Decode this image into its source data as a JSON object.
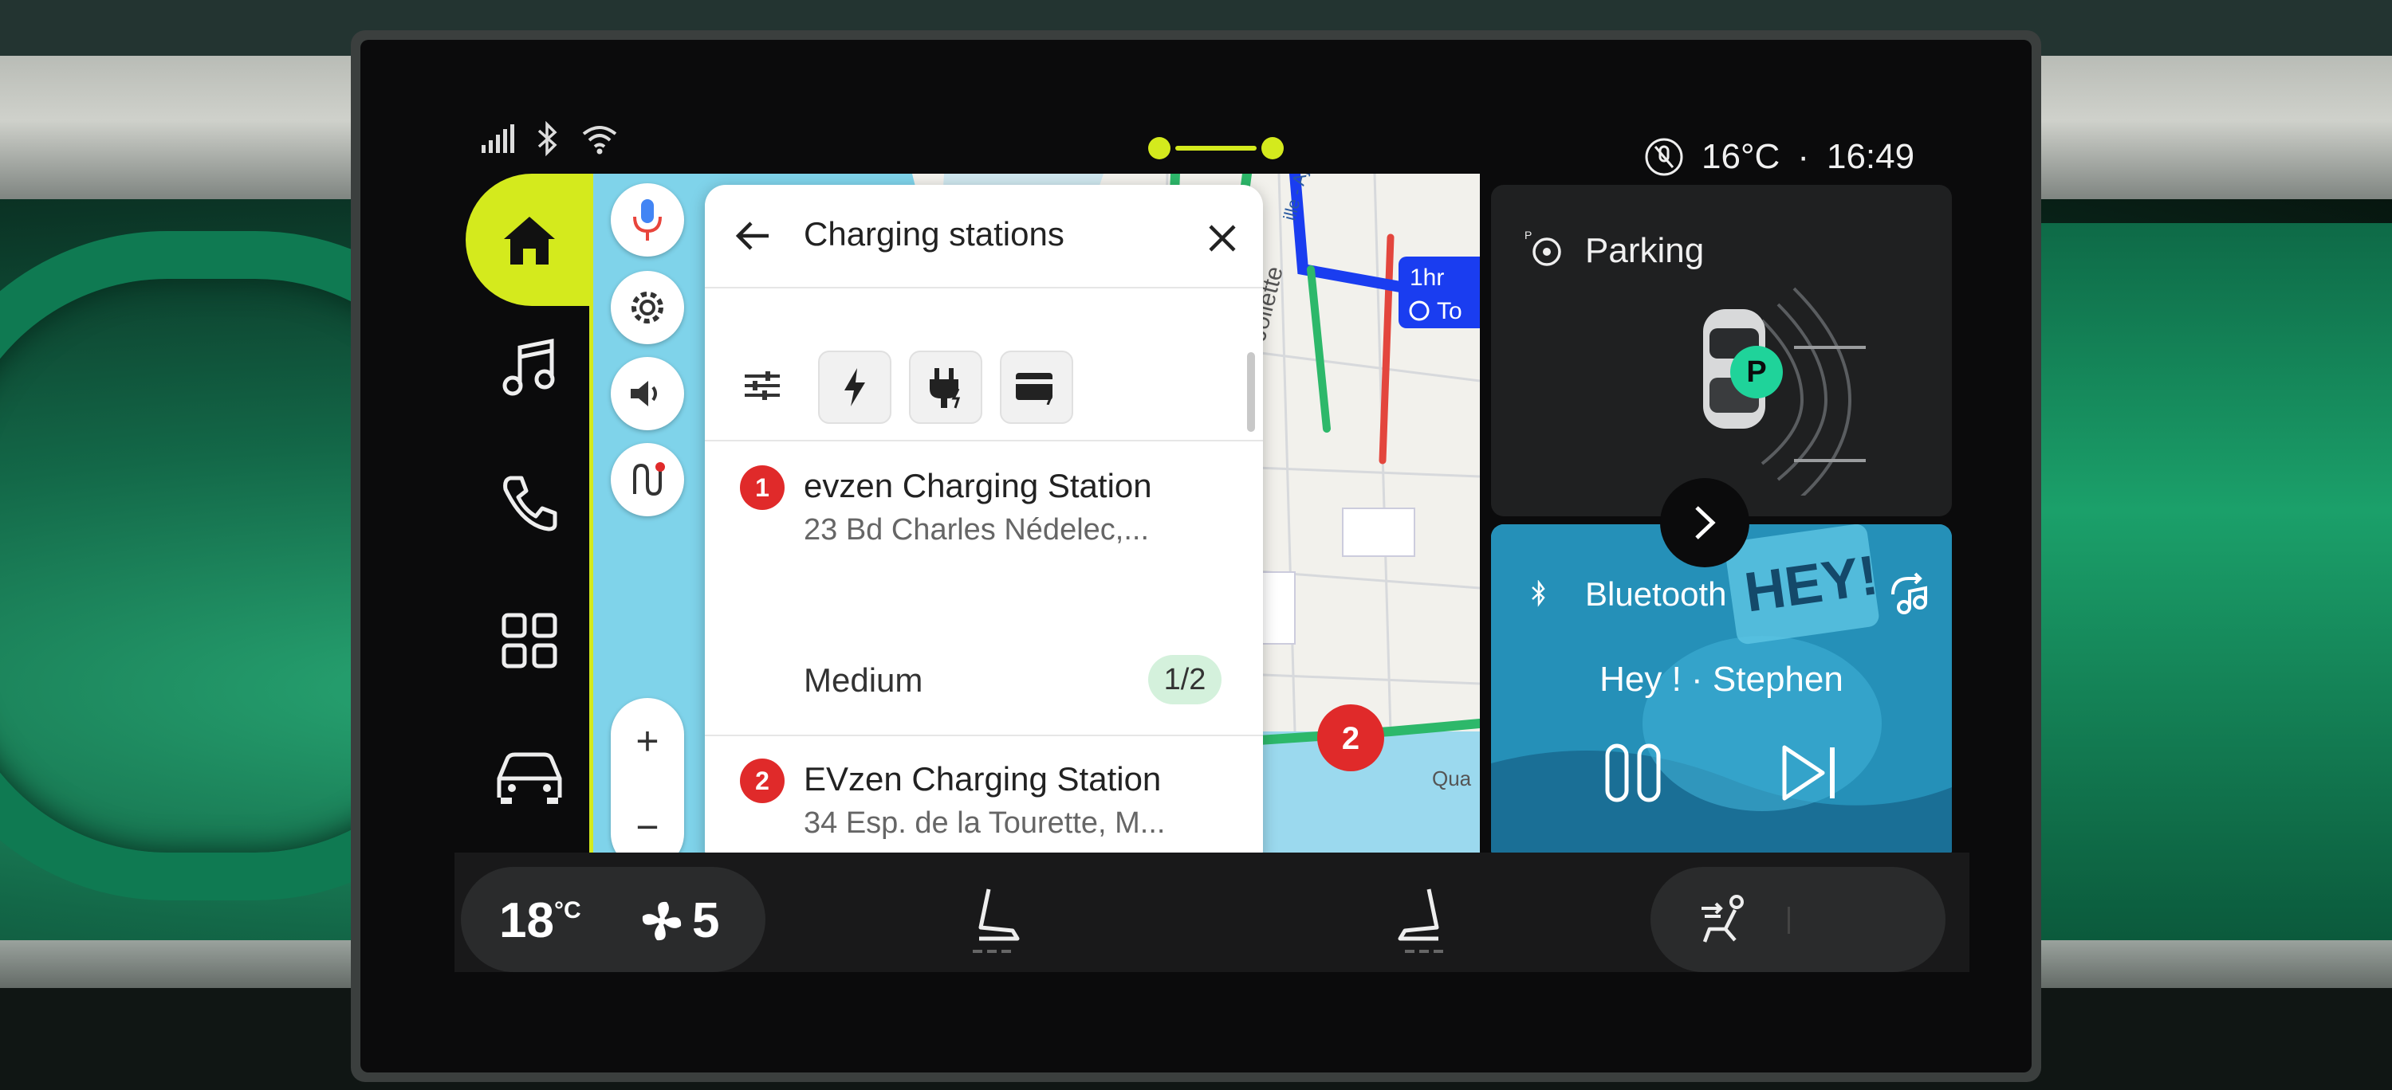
{
  "status_bar": {
    "icons": [
      "signal-icon",
      "bluetooth-icon",
      "wifi-icon"
    ],
    "temperature": "16°C",
    "separator": "·",
    "time": "16:49"
  },
  "rail": {
    "items": [
      {
        "name": "home",
        "icon": "home-icon",
        "active": true
      },
      {
        "name": "music",
        "icon": "music-icon"
      },
      {
        "name": "phone",
        "icon": "phone-icon"
      },
      {
        "name": "apps",
        "icon": "apps-grid-icon"
      },
      {
        "name": "vehicle",
        "icon": "car-icon"
      }
    ]
  },
  "map": {
    "controls": [
      "microphone-icon",
      "settings-icon",
      "volume-icon",
      "route-icon"
    ],
    "zoom_in": "+",
    "zoom_out": "−",
    "route_chip": {
      "duration": "1hr",
      "extra": "To"
    },
    "street_label": "Tun de la Joliette",
    "street_label_2": "ille - Ajaccio",
    "quai_label": "Qua",
    "marker_2": "2"
  },
  "search_panel": {
    "title": "Charging stations",
    "filters": [
      "filter-sliders-icon",
      "bolt-icon",
      "plug-icon",
      "card-icon"
    ],
    "results": [
      {
        "index": "1",
        "name": "evzen Charging Station",
        "address": "23 Bd Charles Nédelec,..."
      },
      {
        "index": "2",
        "name": "EVzen Charging Station",
        "address": "34 Esp. de la Tourette, M..."
      }
    ],
    "speed_label": "Medium",
    "availability": "1/2"
  },
  "parking_widget": {
    "title": "Parking",
    "badge": "P"
  },
  "music_widget": {
    "source": "Bluetooth",
    "track": "Hey ! · Stephen",
    "cover_text": "HEY!"
  },
  "climate": {
    "temperature": "18",
    "unit": "°C",
    "fan_speed": "5"
  },
  "colors": {
    "accent": "#d4ea1d",
    "marker_red": "#e02a2a",
    "availability_green": "#d4f1dc",
    "route_blue": "#1a3df0",
    "parking_badge": "#1fd39a"
  }
}
